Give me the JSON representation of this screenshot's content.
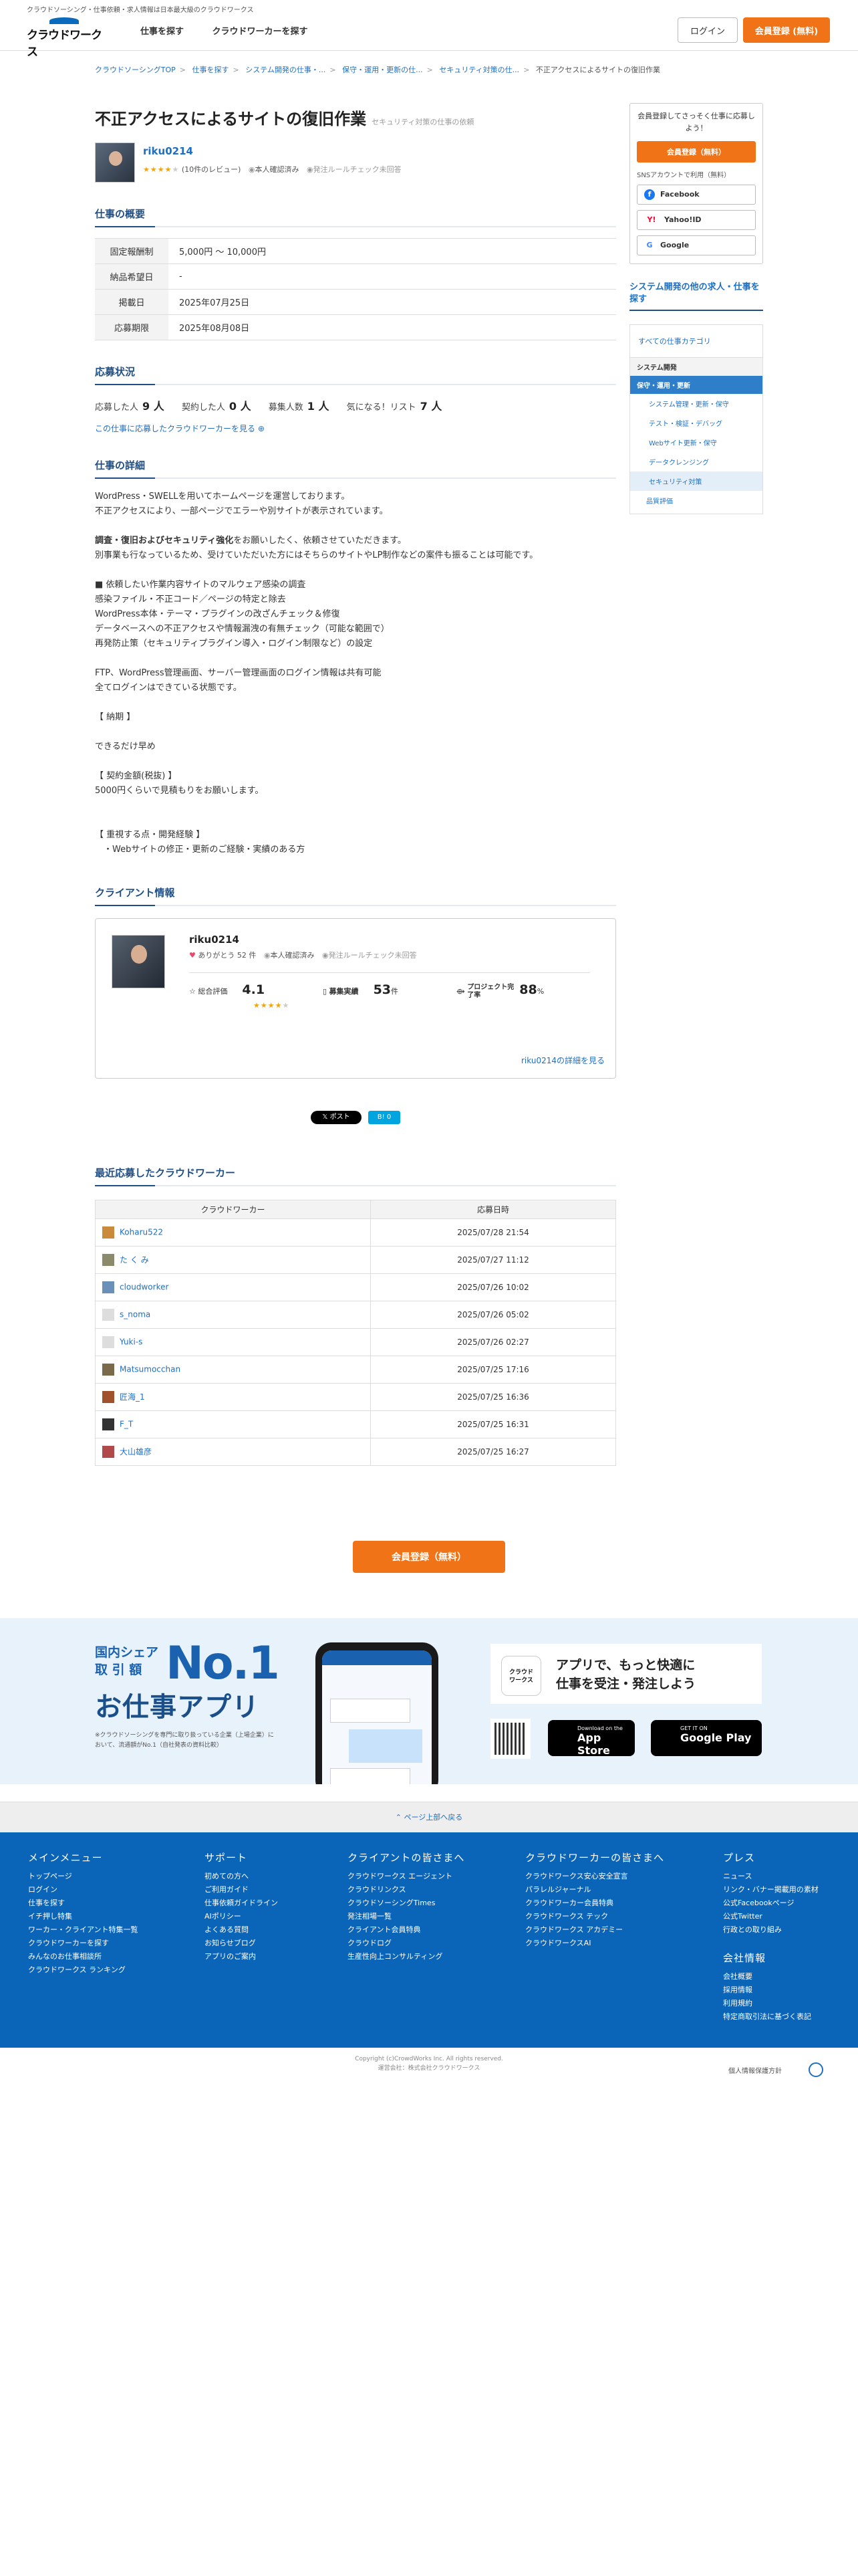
{
  "header": {
    "tagline": "クラウドソーシング・仕事依頼・求人情報は日本最大級のクラウドワークス",
    "logo_text": "クラウドワークス",
    "nav": [
      "仕事を探す",
      "クラウドワーカーを探す"
    ],
    "login": "ログイン",
    "register": "会員登録 (無料)"
  },
  "breadcrumb": [
    "クラウドソーシングTOP",
    "仕事を探す",
    "システム開発の仕事・...",
    "保守・運用・更新の仕...",
    "セキュリティ対策の仕...",
    "不正アクセスによるサイトの復旧作業"
  ],
  "job": {
    "title": "不正アクセスによるサイトの復旧作業",
    "category_note": "セキュリティ対策の仕事の依頼",
    "owner": {
      "name": "riku0214",
      "rating_stars": 4,
      "reviews": "(10件のレビュー)",
      "verified": "本人確認済み",
      "rule_check": "発注ルールチェック未回答"
    }
  },
  "overview": {
    "heading": "仕事の概要",
    "rows": [
      {
        "label": "固定報酬制",
        "value": "5,000円 〜 10,000円"
      },
      {
        "label": "納品希望日",
        "value": "-"
      },
      {
        "label": "掲載日",
        "value": "2025年07月25日"
      },
      {
        "label": "応募期限",
        "value": "2025年08月08日"
      }
    ]
  },
  "applications": {
    "heading": "応募状況",
    "stats": [
      {
        "label": "応募した人",
        "value": "9 人"
      },
      {
        "label": "契約した人",
        "value": "0 人"
      },
      {
        "label": "募集人数",
        "value": "1 人"
      },
      {
        "label": "気になる！リスト",
        "value": "7 人"
      }
    ],
    "more_link": "この仕事に応募したクラウドワーカーを見る"
  },
  "details": {
    "heading": "仕事の詳細",
    "p1": "WordPress・SWELLを用いてホームページを運営しております。\n不正アクセスにより、一部ページでエラーや別サイトが表示されています。",
    "p2_bold": "調査・復旧およびセキュリティ強化",
    "p2_rest": "をお願いしたく、依頼させていただきます。\n別事業も行なっているため、受けていただいた方にはそちらのサイトやLP制作などの案件も振ることは可能です。",
    "p3": "■ 依頼したい作業内容サイトのマルウェア感染の調査\n感染ファイル・不正コード／ページの特定と除去\nWordPress本体・テーマ・プラグインの改ざんチェック＆修復\nデータベースへの不正アクセスや情報漏洩の有無チェック（可能な範囲で）\n再発防止策（セキュリティプラグイン導入・ログイン制限など）の設定",
    "p4": "FTP、WordPress管理画面、サーバー管理画面のログイン情報は共有可能\n全てログインはできている状態です。",
    "p5": "【 納期 】",
    "p6": "できるだけ早め",
    "p7": "【 契約金額(税抜) 】\n5000円くらいで見積もりをお願いします。",
    "p8": "【 重視する点・開発経験 】\n　・Webサイトの修正・更新のご経験・実績のある方"
  },
  "client": {
    "heading": "クライアント情報",
    "name": "riku0214",
    "thanks": "ありがとう 52 件",
    "verified": "本人確認済み",
    "rule_check": "発注ルールチェック未回答",
    "score_label": "総合評価",
    "score": "4.1",
    "score_stars": 4,
    "orders_label": "募集実績",
    "orders": "53",
    "orders_unit": "件",
    "done_label": "プロジェクト完了率",
    "done": "88",
    "done_unit": "%",
    "more": "riku0214の詳細を見る"
  },
  "share": {
    "x": "𝕏 ポスト",
    "hatena": "B! 0"
  },
  "recent": {
    "heading": "最近応募したクラウドワーカー",
    "columns": [
      "クラウドワーカー",
      "応募日時"
    ],
    "rows": [
      {
        "name": "Koharu522",
        "date": "2025/07/28 21:54",
        "color": "#c98a3c"
      },
      {
        "name": "た く み",
        "date": "2025/07/27 11:12",
        "color": "#8b8b6b"
      },
      {
        "name": "cloudworker",
        "date": "2025/07/26 10:02",
        "color": "#6a8fb8"
      },
      {
        "name": "s_noma",
        "date": "2025/07/26 05:02",
        "color": "#dddddd"
      },
      {
        "name": "Yuki-s",
        "date": "2025/07/26 02:27",
        "color": "#dddddd"
      },
      {
        "name": "Matsumocchan",
        "date": "2025/07/25 17:16",
        "color": "#7a6a4a"
      },
      {
        "name": "匠海_1",
        "date": "2025/07/25 16:36",
        "color": "#a0522d"
      },
      {
        "name": "F_T",
        "date": "2025/07/25 16:31",
        "color": "#333333"
      },
      {
        "name": "大山雄彦",
        "date": "2025/07/25 16:27",
        "color": "#b04a4a"
      }
    ]
  },
  "bottom_register": "会員登録（無料）",
  "sidebar": {
    "card_text": "会員登録してさっそく仕事に応募しよう！",
    "register": "会員登録（無料）",
    "sns_text": "SNSアカウントで利用（無料）",
    "sns": [
      {
        "label": "Facebook",
        "icon": "f",
        "color": "#1877f2"
      },
      {
        "label": "Yahoo!ID",
        "icon": "Y!",
        "color": "#ff0033"
      },
      {
        "label": "Google",
        "icon": "G",
        "color": "#4285f4"
      }
    ],
    "related_heading": "システム開発の他の求人・仕事を探す",
    "all_categories": "すべての仕事カテゴリ",
    "cat_l1": "システム開発",
    "cat_l2": "保守・運用・更新",
    "cat_items": [
      "システム管理・更新・保守",
      "テスト・検証・デバッグ",
      "Webサイト更新・保守",
      "データクレンジング",
      "セキュリティ対策"
    ],
    "cat_other": "品質評価"
  },
  "appband": {
    "small": "国内シェア\n取 引 額",
    "no1": "No.1",
    "title": "お仕事アプリ",
    "note": "※クラウドソーシングを専門に取り扱っている企業（上場企業）において、流通額がNo.1（自社発表の資料比較）",
    "app_icon_text": "クラウド\nワークス",
    "app_text": "アプリで、もっと快適に\n仕事を受注・発注しよう",
    "appstore_small": "Download on the",
    "appstore": "App Store",
    "googleplay_small": "GET IT ON",
    "googleplay": "Google Play"
  },
  "pagetop": "ページ上部へ戻る",
  "footer": {
    "cols": [
      {
        "h": "メインメニュー",
        "items": [
          "トップページ",
          "ログイン",
          "仕事を探す",
          "イチ押し特集",
          "ワーカー・クライアント特集一覧",
          "クラウドワーカーを探す",
          "みんなのお仕事相談所",
          "クラウドワークス ランキング"
        ]
      },
      {
        "h": "サポート",
        "items": [
          "初めての方へ",
          "ご利用ガイド",
          "仕事依頼ガイドライン",
          "AIポリシー",
          "よくある質問",
          "お知らせブログ",
          "アプリのご案内"
        ]
      },
      {
        "h": "クライアントの皆さまへ",
        "items": [
          "クラウドワークス エージェント",
          "クラウドリンクス",
          "クラウドソーシングTimes",
          "発注相場一覧",
          "クライアント会員特典",
          "クラウドログ",
          "生産性向上コンサルティング"
        ]
      },
      {
        "h": "クラウドワーカーの皆さまへ",
        "items": [
          "クラウドワークス安心安全宣言",
          "パラレルジャーナル",
          "クラウドワーカー会員特典",
          "クラウドワークス テック",
          "クラウドワークス アカデミー",
          "クラウドワークスAI"
        ]
      },
      {
        "h": "プレス",
        "items": [
          "ニュース",
          "リンク・バナー掲載用の素材",
          "公式Facebookページ",
          "公式Twitter",
          "行政との取り組み"
        ]
      },
      {
        "h": "会社情報",
        "items": [
          "会社概要",
          "採用情報",
          "利用規約",
          "特定商取引法に基づく表記"
        ]
      }
    ],
    "copyright": "Copyright (c)CrowdWorks Inc. All rights reserved.",
    "operator": "運営会社：株式会社クラウドワークス",
    "privacy": "個人情報保護方針"
  }
}
